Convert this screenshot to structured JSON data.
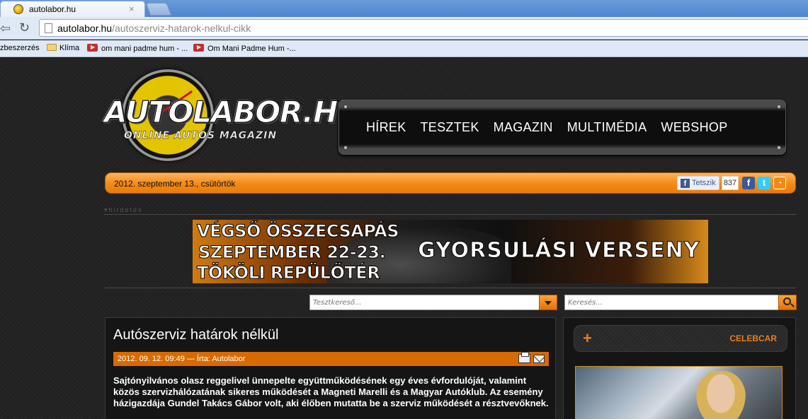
{
  "browser": {
    "tab_title": "autolabor.hu",
    "tab_close": "×",
    "url_domain": "autolabor.hu",
    "url_path": "/autoszerviz-hatarok-nelkul-cikk",
    "bookmarks": [
      {
        "label": "zbeszerzés",
        "icon": "none"
      },
      {
        "label": "Klíma",
        "icon": "folder-icon"
      },
      {
        "label": "om mani padme hum - ...",
        "icon": "youtube-icon"
      },
      {
        "label": "Om Mani Padme Hum -...",
        "icon": "youtube-icon"
      }
    ]
  },
  "site": {
    "logo_text": "AUTOLABOR.HU",
    "logo_subtitle": "ONLINE AUTÓS MAGAZIN",
    "nav": [
      "HÍREK",
      "TESZTEK",
      "MAGAZIN",
      "MULTIMÉDIA",
      "WEBSHOP"
    ],
    "date": "2012. szeptember 13., csütörtök",
    "like_label": "Tetszik",
    "like_count": "837",
    "ad_label": "hirdetés",
    "banner": {
      "line1": "VÉGSŐ ÖSSZECSAPÁS",
      "line2": "SZEPTEMBER 22-23.",
      "line3": "TÖKÖLI REPÜLŐTÉR",
      "right": "GYORSULÁSI VERSENY"
    },
    "test_search_placeholder": "Tesztkereső...",
    "search_placeholder": "Keresés..."
  },
  "article": {
    "title": "Autószerviz határok nélkül",
    "meta": "2012. 09. 12. 09:49 — Írta: Autolabor",
    "lead": "Sajtónyilvános olasz reggelivel ünnepelte együttműködésének egy éves évfordulóját, valamint közös szervizhálózatának sikeres működését a Magneti Marelli és a Magyar Autóklub. Az esemény házigazdája Gundel Takács Gábor volt, aki élőben mutatta be a szerviz működését a résztvevőknek."
  },
  "sidebar": {
    "box_title": "CELEBCAR",
    "plus": "+"
  },
  "colors": {
    "accent": "#f38a16",
    "meta_bar": "#d86b00",
    "background": "#1a1a1a"
  }
}
